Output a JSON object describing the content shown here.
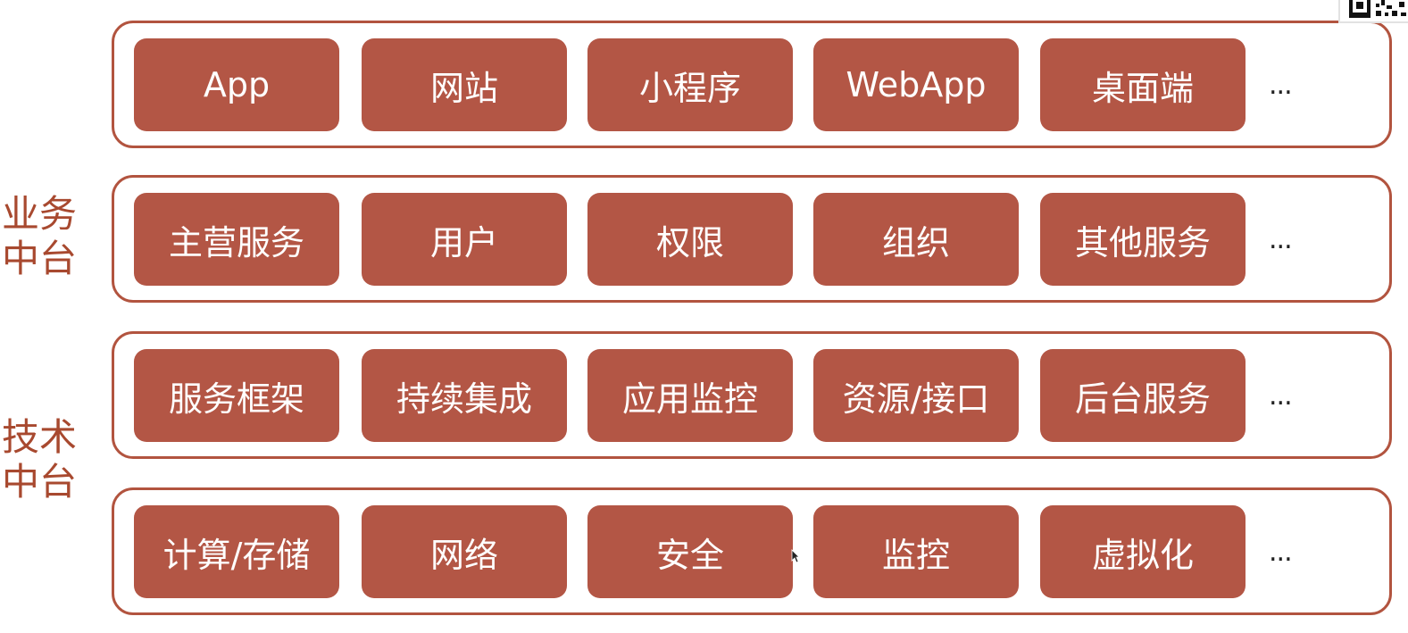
{
  "side_labels": {
    "business": [
      "业务",
      "中台"
    ],
    "technical": [
      "技术",
      "中台"
    ]
  },
  "layers": [
    {
      "items": [
        "App",
        "网站",
        "小程序",
        "WebApp",
        "桌面端"
      ],
      "more": "..."
    },
    {
      "items": [
        "主营服务",
        "用户",
        "权限",
        "组织",
        "其他服务"
      ],
      "more": "..."
    },
    {
      "items": [
        "服务框架",
        "持续集成",
        "应用监控",
        "资源/接口",
        "后台服务"
      ],
      "more": "..."
    },
    {
      "items": [
        "计算/存储",
        "网络",
        "安全",
        "监控",
        "虚拟化"
      ],
      "more": "..."
    }
  ],
  "colors": {
    "box_fill": "#b35645",
    "layer_border": "#b2543f",
    "label_text": "#a8492f"
  },
  "icons": [
    "qr-code-icon",
    "mouse-cursor-icon"
  ]
}
